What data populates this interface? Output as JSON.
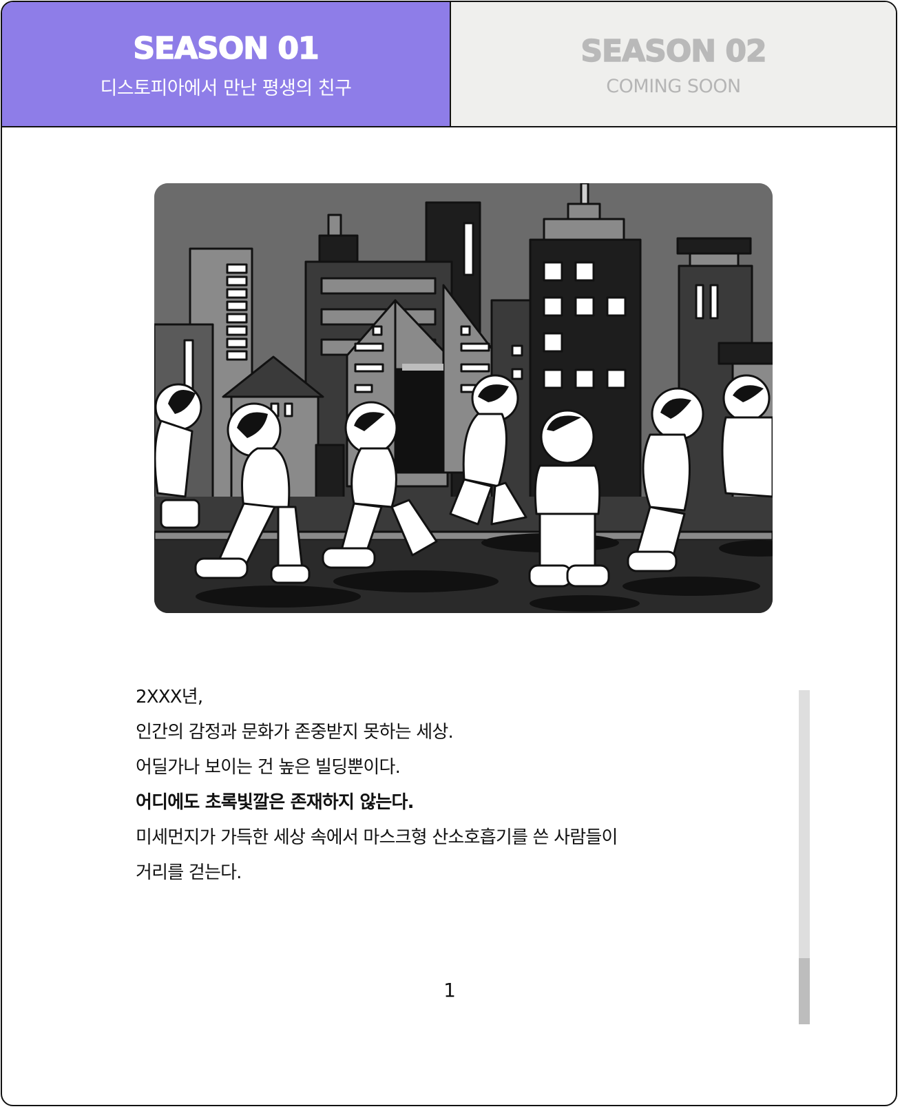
{
  "tabs": [
    {
      "title": "SEASON 01",
      "subtitle": "디스토피아에서 만난 평생의 친구",
      "active": true,
      "color": "#8e7de8"
    },
    {
      "title": "SEASON 02",
      "subtitle": "COMING SOON",
      "active": false,
      "color": "#efefed"
    }
  ],
  "illustration": {
    "icon": "city-astronauts-illustration"
  },
  "story": {
    "lines": [
      {
        "text": "2XXX년,",
        "bold": false
      },
      {
        "text": "인간의 감정과 문화가 존중받지 못하는 세상.",
        "bold": false
      },
      {
        "text": "어딜가나 보이는 건 높은 빌딩뿐이다.",
        "bold": false
      },
      {
        "text": "어디에도 초록빛깔은 존재하지 않는다.",
        "bold": true
      },
      {
        "text": "미세먼지가 가득한 세상 속에서 마스크형 산소호흡기를 쓴 사람들이",
        "bold": false
      },
      {
        "text": "거리를 걷는다.",
        "bold": false
      }
    ]
  },
  "page_number": "1",
  "scroll": {
    "position": 1.0
  }
}
